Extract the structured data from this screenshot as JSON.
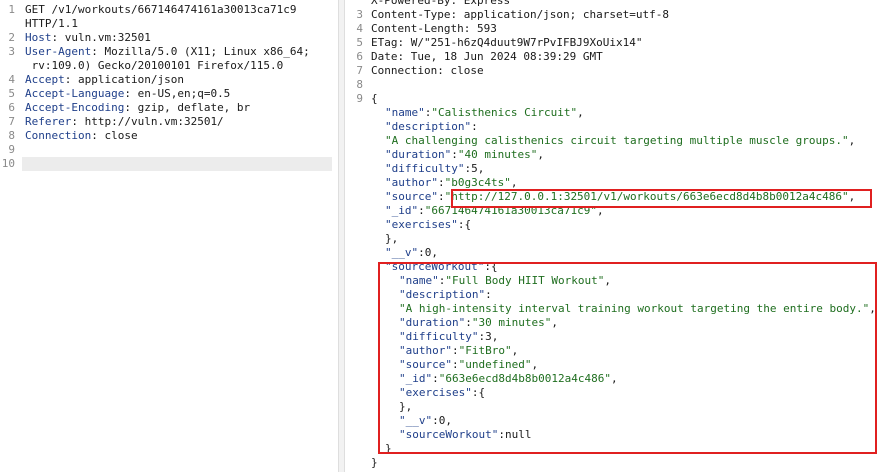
{
  "request": {
    "lines": [
      {
        "n": "1",
        "text": "GET /v1/workouts/667146474161a30013ca71c9"
      },
      {
        "n": "",
        "text": "HTTP/1.1"
      },
      {
        "n": "2",
        "k": "Host",
        "v": "vuln.vm:32501"
      },
      {
        "n": "3",
        "k": "User-Agent",
        "v": "Mozilla/5.0 (X11; Linux x86_64;"
      },
      {
        "n": "",
        "text": " rv:109.0) Gecko/20100101 Firefox/115.0"
      },
      {
        "n": "4",
        "k": "Accept",
        "v": "application/json"
      },
      {
        "n": "5",
        "k": "Accept-Language",
        "v": "en-US,en;q=0.5"
      },
      {
        "n": "6",
        "k": "Accept-Encoding",
        "v": "gzip, deflate, br"
      },
      {
        "n": "7",
        "k": "Referer",
        "v": "http://vuln.vm:32501/"
      },
      {
        "n": "8",
        "k": "Connection",
        "v": "close"
      },
      {
        "n": "9",
        "text": ""
      },
      {
        "n": "10",
        "text": ""
      }
    ]
  },
  "response": {
    "lines": [
      {
        "n": "",
        "text": "X-Powered-By: Express"
      },
      {
        "n": "3",
        "text": "Content-Type: application/json; charset=utf-8"
      },
      {
        "n": "4",
        "text": "Content-Length: 593"
      },
      {
        "n": "5",
        "text": "ETag: W/\"251-h6zQ4duut9W7rPvIFBJ9XoUix14\""
      },
      {
        "n": "6",
        "text": "Date: Tue, 18 Jun 2024 08:39:29 GMT"
      },
      {
        "n": "7",
        "text": "Connection: close"
      },
      {
        "n": "8",
        "text": ""
      },
      {
        "n": "9",
        "text": "{"
      },
      {
        "n": "",
        "ind": 1,
        "k": "\"name\"",
        "v": "\"Calisthenics Circuit\"",
        "t": ","
      },
      {
        "n": "",
        "ind": 1,
        "k": "\"description\"",
        "v": "",
        "t": ""
      },
      {
        "n": "",
        "ind": 1,
        "k": "",
        "v": "\"A challenging calisthenics circuit targeting multiple muscle groups.\"",
        "t": ","
      },
      {
        "n": "",
        "ind": 1,
        "k": "\"duration\"",
        "v": "\"40 minutes\"",
        "t": ","
      },
      {
        "n": "",
        "ind": 1,
        "k": "\"difficulty\"",
        "v": "5",
        "t": ","
      },
      {
        "n": "",
        "ind": 1,
        "k": "\"author\"",
        "v": "\"b0g3c4ts\"",
        "t": ","
      },
      {
        "n": "",
        "ind": 1,
        "k": "\"source\"",
        "v": "\"http://127.0.0.1:32501/v1/workouts/663e6ecd8d4b8b0012a4c486\"",
        "t": ","
      },
      {
        "n": "",
        "ind": 1,
        "k": "\"_id\"",
        "v": "\"667146474161a30013ca71c9\"",
        "t": ","
      },
      {
        "n": "",
        "ind": 1,
        "k": "\"exercises\"",
        "v": "{",
        "t": ""
      },
      {
        "n": "",
        "ind": 1,
        "k": "",
        "v": "},",
        "t": ""
      },
      {
        "n": "",
        "ind": 1,
        "k": "\"__v\"",
        "v": "0",
        "t": ","
      },
      {
        "n": "",
        "ind": 1,
        "k": "\"sourceWorkout\"",
        "v": "{",
        "t": ""
      },
      {
        "n": "",
        "ind": 2,
        "k": "\"name\"",
        "v": "\"Full Body HIIT Workout\"",
        "t": ","
      },
      {
        "n": "",
        "ind": 2,
        "k": "\"description\"",
        "v": "",
        "t": ""
      },
      {
        "n": "",
        "ind": 2,
        "k": "",
        "v": "\"A high-intensity interval training workout targeting the entire body.\"",
        "t": ","
      },
      {
        "n": "",
        "ind": 2,
        "k": "\"duration\"",
        "v": "\"30 minutes\"",
        "t": ","
      },
      {
        "n": "",
        "ind": 2,
        "k": "\"difficulty\"",
        "v": "3",
        "t": ","
      },
      {
        "n": "",
        "ind": 2,
        "k": "\"author\"",
        "v": "\"FitBro\"",
        "t": ","
      },
      {
        "n": "",
        "ind": 2,
        "k": "\"source\"",
        "v": "\"undefined\"",
        "t": ","
      },
      {
        "n": "",
        "ind": 2,
        "k": "\"_id\"",
        "v": "\"663e6ecd8d4b8b0012a4c486\"",
        "t": ","
      },
      {
        "n": "",
        "ind": 2,
        "k": "\"exercises\"",
        "v": "{",
        "t": ""
      },
      {
        "n": "",
        "ind": 2,
        "k": "",
        "v": "},",
        "t": ""
      },
      {
        "n": "",
        "ind": 2,
        "k": "\"__v\"",
        "v": "0",
        "t": ","
      },
      {
        "n": "",
        "ind": 2,
        "k": "\"sourceWorkout\"",
        "v": "null",
        "t": ""
      },
      {
        "n": "",
        "ind": 1,
        "k": "",
        "v": "}",
        "t": ""
      },
      {
        "n": "",
        "ind": 0,
        "k": "",
        "v": "}",
        "t": ""
      }
    ]
  },
  "colors": {
    "highlight_box": "#e02020",
    "key": "#1f3f8a",
    "string": "#1f6e1f"
  }
}
